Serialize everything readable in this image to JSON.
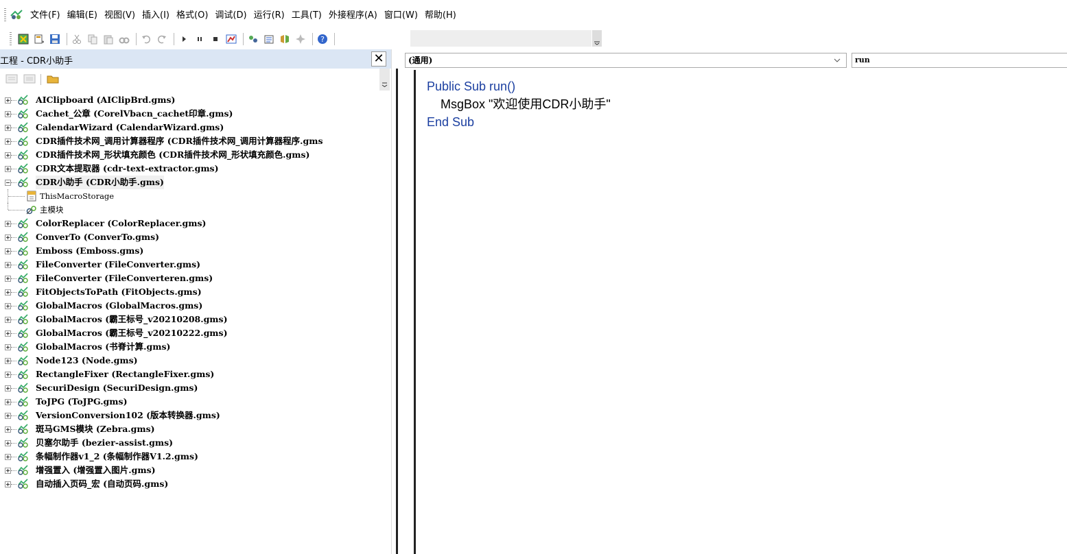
{
  "menubar": {
    "items": [
      "文件(F)",
      "编辑(E)",
      "视图(V)",
      "插入(I)",
      "格式(O)",
      "调试(D)",
      "运行(R)",
      "工具(T)",
      "外接程序(A)",
      "窗口(W)",
      "帮助(H)"
    ]
  },
  "toolbar": {
    "icons": [
      "view-host-icon",
      "insert-module-icon",
      "save-icon",
      "cut-icon",
      "copy-icon",
      "paste-icon",
      "find-icon",
      "undo-icon",
      "redo-icon",
      "run-icon",
      "break-icon",
      "reset-icon",
      "design-mode-icon",
      "project-explorer-icon",
      "properties-icon",
      "object-browser-icon",
      "toolbox-icon",
      "help-icon"
    ]
  },
  "project": {
    "title": "工程 - CDR小助手",
    "close": "✕",
    "tree": [
      {
        "label": "AIClipboard (AIClipBrd.gms)"
      },
      {
        "label": "Cachet_公章 (CorelVbacn_cachet印章.gms)"
      },
      {
        "label": "CalendarWizard (CalendarWizard.gms)"
      },
      {
        "label": "CDR插件技术网_调用计算器程序 (CDR插件技术网_调用计算器程序.gms"
      },
      {
        "label": "CDR插件技术网_形状填充颜色 (CDR插件技术网_形状填充颜色.gms)"
      },
      {
        "label": "CDR文本提取器 (cdr-text-extractor.gms)"
      },
      {
        "label": "CDR小助手 (CDR小助手.gms)",
        "expanded": true,
        "children": [
          "ThisMacroStorage",
          "主模块"
        ]
      },
      {
        "label": "ColorReplacer (ColorReplacer.gms)"
      },
      {
        "label": "ConverTo (ConverTo.gms)"
      },
      {
        "label": "Emboss (Emboss.gms)"
      },
      {
        "label": "FileConverter (FileConverter.gms)"
      },
      {
        "label": "FileConverter (FileConverteren.gms)"
      },
      {
        "label": "FitObjectsToPath (FitObjects.gms)"
      },
      {
        "label": "GlobalMacros (GlobalMacros.gms)"
      },
      {
        "label": "GlobalMacros (霸王标号_v20210208.gms)"
      },
      {
        "label": "GlobalMacros (霸王标号_v20210222.gms)"
      },
      {
        "label": "GlobalMacros (书脊计算.gms)"
      },
      {
        "label": "Node123 (Node.gms)"
      },
      {
        "label": "RectangleFixer (RectangleFixer.gms)"
      },
      {
        "label": "SecuriDesign (SecuriDesign.gms)"
      },
      {
        "label": "ToJPG (ToJPG.gms)"
      },
      {
        "label": "VersionConversion102 (版本转换器.gms)"
      },
      {
        "label": "斑马GMS模块 (Zebra.gms)"
      },
      {
        "label": "贝塞尔助手 (bezier-assist.gms)"
      },
      {
        "label": "条幅制作器v1_2 (条幅制作器V1.2.gms)"
      },
      {
        "label": "增强置入 (增强置入图片.gms)"
      },
      {
        "label": "自动插入页码_宏 (自动页码.gms)"
      }
    ]
  },
  "code": {
    "object_combo": "(通用)",
    "proc_combo": "run",
    "lines": [
      [
        {
          "t": "Public Sub run()",
          "kw": true
        }
      ],
      [
        {
          "t": "    MsgBox \"欢迎使用CDR小助手\"",
          "kw": false
        }
      ],
      [
        {
          "t": "End Sub",
          "kw": true
        }
      ]
    ]
  },
  "colors": {
    "keyword": "#1b3fa0",
    "title_bar": "#dbe6f4"
  }
}
